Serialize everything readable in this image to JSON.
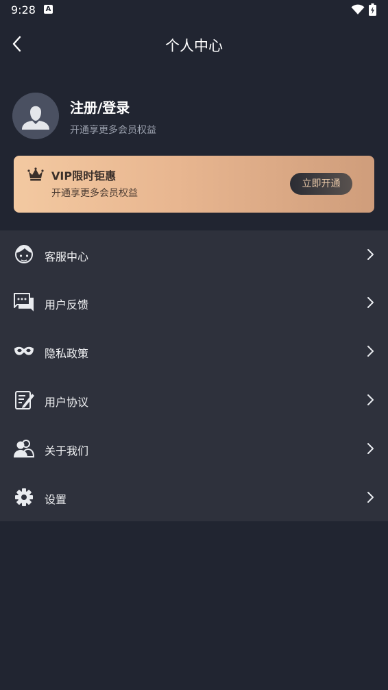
{
  "status_bar": {
    "time": "9:28",
    "a_badge": "A"
  },
  "header": {
    "title": "个人中心"
  },
  "profile": {
    "login_label": "注册/登录",
    "subtitle": "开通享更多会员权益"
  },
  "vip": {
    "title": "VIP限时钜惠",
    "subtitle": "开通享更多会员权益",
    "button_label": "立即开通"
  },
  "menu": {
    "items": [
      {
        "label": "客服中心",
        "icon": "customer-service-icon"
      },
      {
        "label": "用户反馈",
        "icon": "feedback-icon"
      },
      {
        "label": "隐私政策",
        "icon": "mask-icon"
      },
      {
        "label": "用户协议",
        "icon": "agreement-icon"
      },
      {
        "label": "关于我们",
        "icon": "users-icon"
      },
      {
        "label": "设置",
        "icon": "gear-icon"
      }
    ]
  },
  "colors": {
    "background": "#212531",
    "menu_background": "#2e313c",
    "vip_gradient_start": "#f3c9a1",
    "vip_gradient_end": "#cf9d7b"
  }
}
